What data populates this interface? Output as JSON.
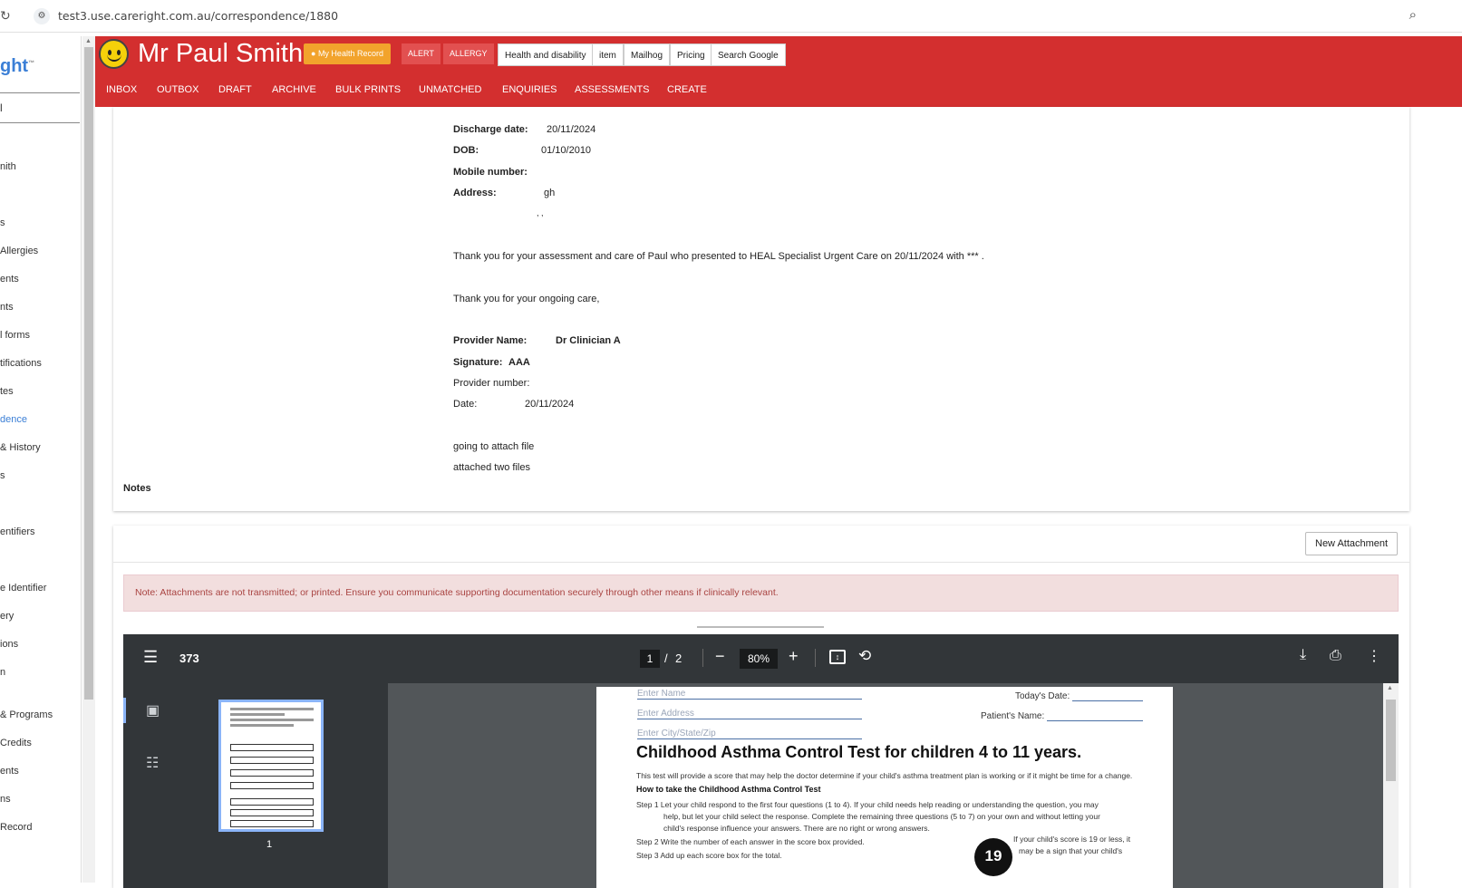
{
  "browser": {
    "url": "test3.use.careright.com.au/correspondence/1880"
  },
  "leftnav": {
    "brand": "ght",
    "brand_tm": "™",
    "selected": "l",
    "items": [
      {
        "label": "nith"
      },
      {
        "label": "s"
      },
      {
        "label": " Allergies"
      },
      {
        "label": "ents"
      },
      {
        "label": "nts"
      },
      {
        "label": "l forms"
      },
      {
        "label": "tifications"
      },
      {
        "label": "tes"
      },
      {
        "label": "dence"
      },
      {
        "label": "& History"
      },
      {
        "label": "s"
      },
      {
        "label": "entifiers"
      },
      {
        "label": "e Identifier"
      },
      {
        "label": "ery"
      },
      {
        "label": "ions"
      },
      {
        "label": "n"
      },
      {
        "label": "& Programs"
      },
      {
        "label": " Credits"
      },
      {
        "label": "ents"
      },
      {
        "label": "ns"
      },
      {
        "label": " Record"
      }
    ],
    "active_index": 8
  },
  "header": {
    "patient_name": "Mr Paul Smith",
    "my_health_record": "My Health Record",
    "alert": "ALERT",
    "allergy": "ALLERGY",
    "links": [
      "Health and disability",
      "item",
      "Mailhog",
      "Pricing",
      "Search Google"
    ],
    "tabs": [
      "INBOX",
      "OUTBOX",
      "DRAFT",
      "ARCHIVE",
      "BULK PRINTS",
      "UNMATCHED",
      "ENQUIRIES",
      "ASSESSMENTS",
      "CREATE"
    ]
  },
  "letter": {
    "discharge_label": "Discharge date:",
    "discharge_value": "20/11/2024",
    "dob_label": "DOB:",
    "dob_value": "01/10/2010",
    "mobile_label": "Mobile number:",
    "address_label": "Address:",
    "address_value": "gh",
    "address_line2": ", ,",
    "para1": "Thank you for your assessment and care of Paul who presented to HEAL Specialist Urgent Care on 20/11/2024 with *** .",
    "para2": "Thank you for your ongoing care,",
    "provider_label": "Provider Name:",
    "provider_value": "Dr Clinician A",
    "signature_label": "Signature:",
    "signature_value": "AAA",
    "provider_number_label": "Provider number:",
    "date_label": "Date:",
    "date_value": "20/11/2024",
    "note1": "going to attach file",
    "note2": "attached two files",
    "notes_heading": "Notes"
  },
  "attachments": {
    "new_button": "New Attachment",
    "warning": "Note: Attachments are not transmitted; or printed. Ensure you communicate supporting documentation securely through other means if clinically relevant."
  },
  "pdf_viewer": {
    "doc_title": "373",
    "page_current": "1",
    "page_sep": "/",
    "page_total": "2",
    "zoom": "80%",
    "thumb_label": "1",
    "page": {
      "enter_name": "Enter Name",
      "enter_address": "Enter Address",
      "enter_city": "Enter City/State/Zip",
      "todays_date": "Today's Date:",
      "patients_name": "Patient's Name:",
      "title": "Childhood Asthma Control Test for children 4 to 11 years.",
      "intro": "This test will provide a score that may help the doctor determine if your child's asthma treatment plan is working or if it might be time for a change.",
      "how_to": "How to take the Childhood Asthma Control Test",
      "step1a": "Step 1  Let your child respond to the first four questions (1 to 4). If your child needs help reading or understanding the question, you may",
      "step1b": "help, but let your child select the response. Complete the remaining three questions (5 to 7) on your own and without letting your",
      "step1c": "child's response influence your answers. There are no right or wrong answers.",
      "step2": "Step 2  Write the number of each answer in the score box provided.",
      "step3": "Step 3  Add up each score box for the total.",
      "badge": "19",
      "badge_text1": "If your child's score is 19 or less, it",
      "badge_text2": "may be a sign that your child's"
    }
  },
  "colors": {
    "header_red": "#d32f2f",
    "mhr_orange": "#f2a32c",
    "link_blue": "#3b7fd6",
    "alert_bg": "#f2dede",
    "alert_text": "#a94442"
  }
}
